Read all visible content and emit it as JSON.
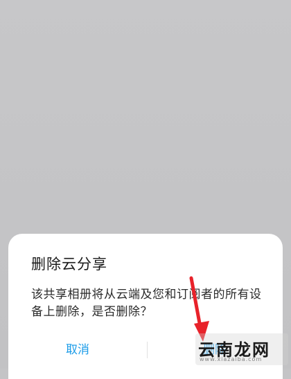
{
  "dialog": {
    "title": "删除云分享",
    "message": "该共享相册将从云端及您和订阅者的所有设备上删除，是否删除？",
    "cancel_label": "取消",
    "delete_label": "删除"
  },
  "watermark": {
    "text": "云南龙网",
    "url": "www.xiazaiba.com"
  },
  "colors": {
    "accent": "#1a9be8",
    "arrow": "#e8222a",
    "backdrop": "#c4c4c6"
  }
}
